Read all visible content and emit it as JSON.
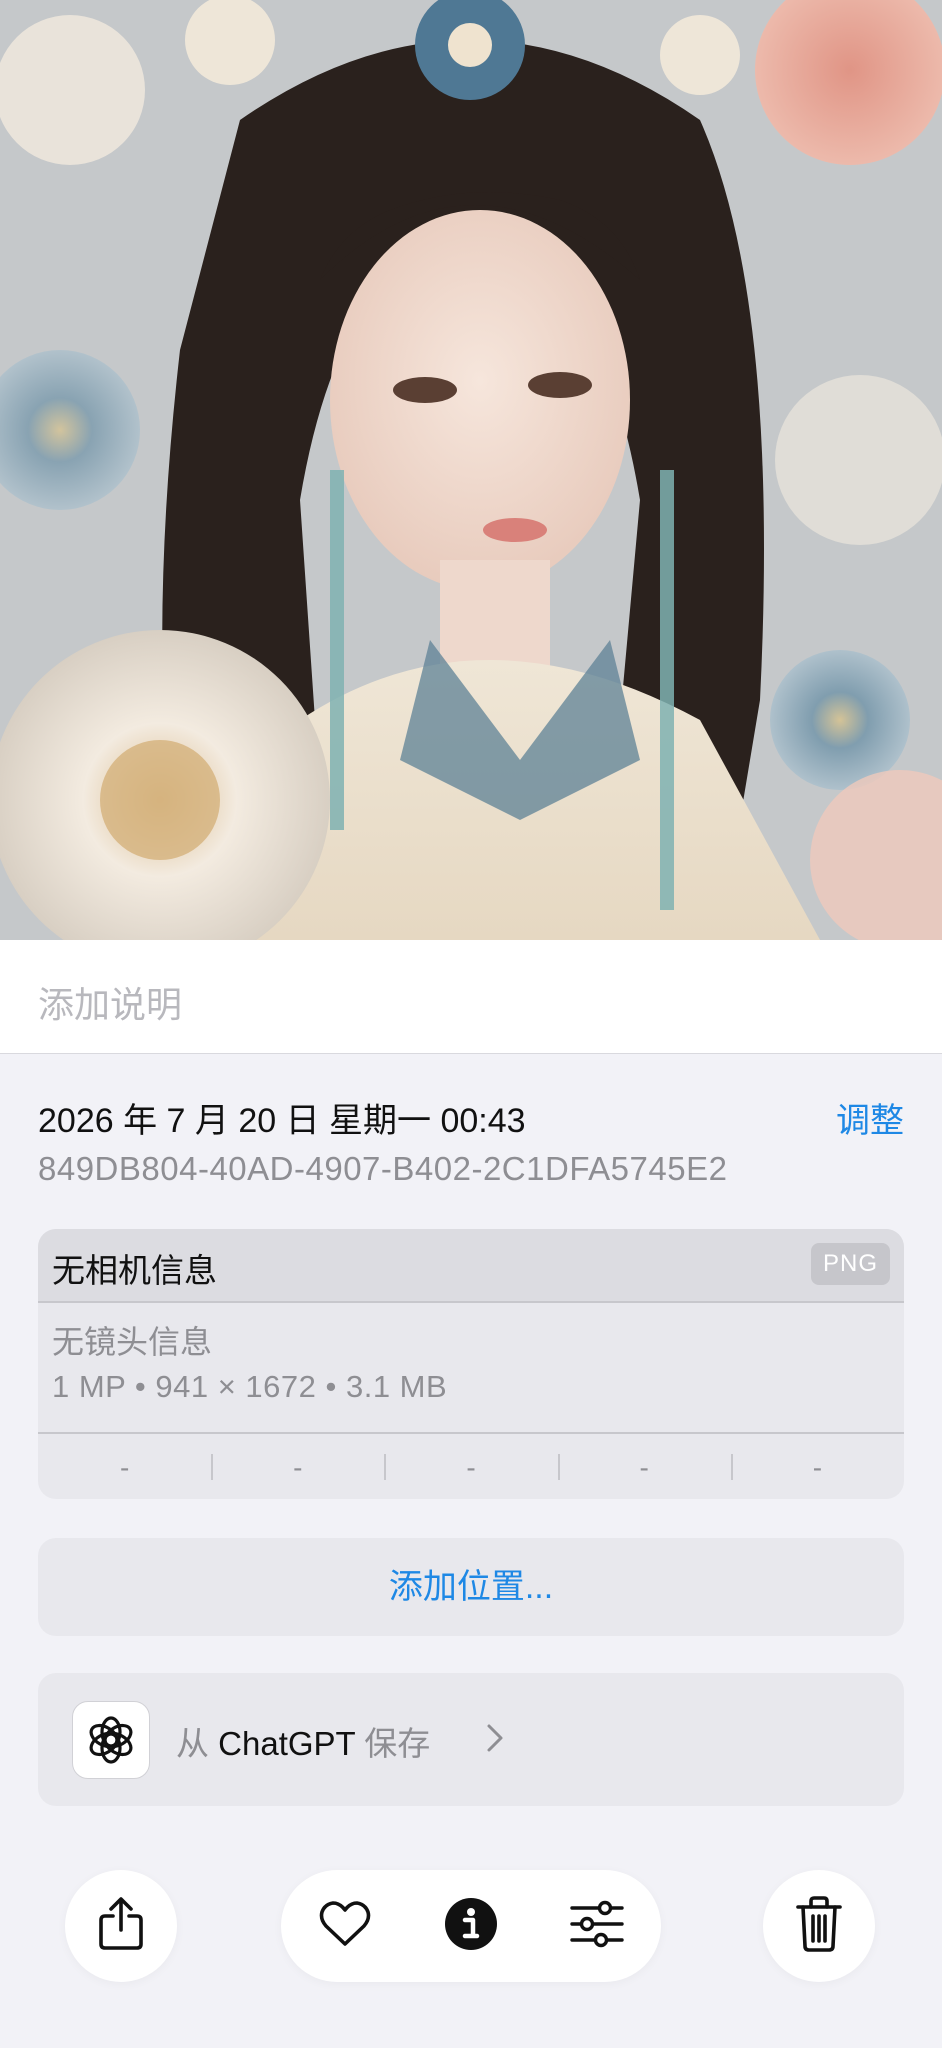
{
  "caption": {
    "placeholder": "添加说明"
  },
  "details": {
    "datetime": "2026 年 7 月 20 日 星期一 00:43",
    "adjust_label": "调整",
    "asset_id": "849DB804-40AD-4907-B402-2C1DFA5745E2"
  },
  "camera": {
    "title": "无相机信息",
    "format_badge": "PNG",
    "lens": "无镜头信息",
    "specs": "1 MP • 941 × 1672 • 3.1 MB",
    "exif": [
      "-",
      "-",
      "-",
      "-",
      "-"
    ]
  },
  "location": {
    "add_label": "添加位置..."
  },
  "source": {
    "prefix": "从",
    "app_name": "ChatGPT",
    "suffix": "保存",
    "icon": "chatgpt-logo-icon"
  },
  "toolbar": {
    "icons": [
      "share-icon",
      "heart-icon",
      "info-icon",
      "sliders-icon",
      "trash-icon"
    ]
  },
  "colors": {
    "accent": "#1e88e5",
    "background": "#f2f2f7",
    "card": "#e8e8ed"
  }
}
